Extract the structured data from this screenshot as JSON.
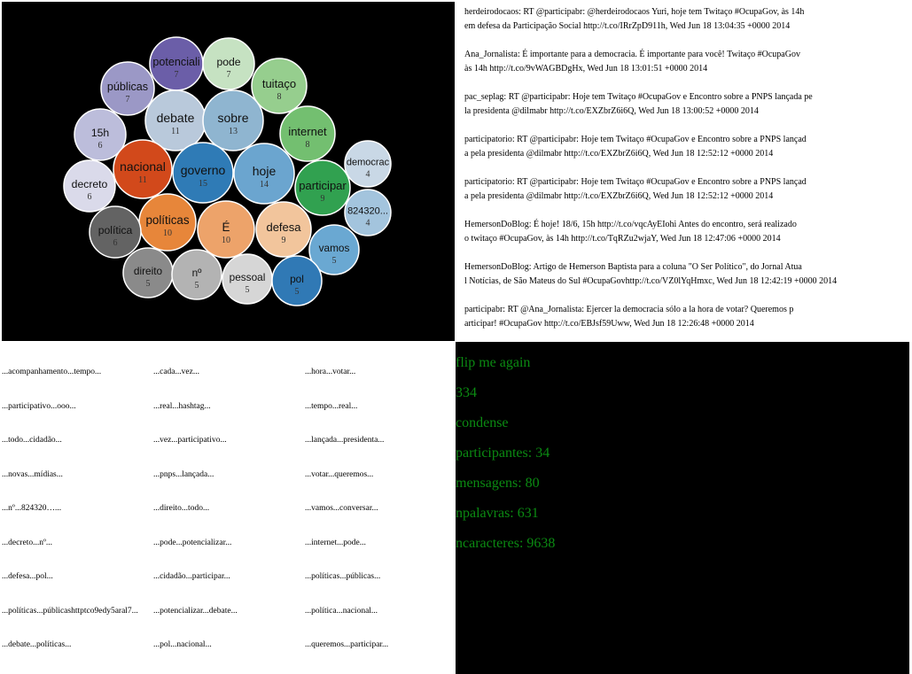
{
  "bubbles": [
    {
      "word": "potenciali",
      "count": "7",
      "color": "#6b5ea8"
    },
    {
      "word": "pode",
      "count": "7",
      "color": "#c6e2c2"
    },
    {
      "word": "públicas",
      "count": "7",
      "color": "#9b98c6"
    },
    {
      "word": "tuitaço",
      "count": "8",
      "color": "#96ce8e"
    },
    {
      "word": "debate",
      "count": "11",
      "color": "#b9c9db"
    },
    {
      "word": "sobre",
      "count": "13",
      "color": "#8fb5d0"
    },
    {
      "word": "15h",
      "count": "6",
      "color": "#bcbddb"
    },
    {
      "word": "internet",
      "count": "8",
      "color": "#73bf70"
    },
    {
      "word": "nacional",
      "count": "11",
      "color": "#d2491b"
    },
    {
      "word": "governo",
      "count": "15",
      "color": "#2f7bb6"
    },
    {
      "word": "hoje",
      "count": "14",
      "color": "#6ba5cf"
    },
    {
      "word": "democrac",
      "count": "4",
      "color": "#c9d8e6"
    },
    {
      "word": "decreto",
      "count": "6",
      "color": "#dadaea"
    },
    {
      "word": "participar",
      "count": "9",
      "color": "#31a150"
    },
    {
      "word": "824320...",
      "count": "4",
      "color": "#a3c4dd"
    },
    {
      "word": "políticas",
      "count": "10",
      "color": "#e7863a"
    },
    {
      "word": "É",
      "count": "10",
      "color": "#eda36a"
    },
    {
      "word": "política",
      "count": "6",
      "color": "#636363"
    },
    {
      "word": "defesa",
      "count": "9",
      "color": "#f2c59c"
    },
    {
      "word": "vamos",
      "count": "5",
      "color": "#6aa8d2"
    },
    {
      "word": "direito",
      "count": "5",
      "color": "#8a8a8a"
    },
    {
      "word": "nº",
      "count": "5",
      "color": "#b3b3b3"
    },
    {
      "word": "pessoal",
      "count": "5",
      "color": "#d6d6d6"
    },
    {
      "word": "pol",
      "count": "5",
      "color": "#3079b5"
    }
  ],
  "tweets": [
    {
      "l1": "herdeirodocaos: RT @participabr: @herdeirodocaos Yuri, hoje tem Twitaço #OcupaGov, às 14h",
      "l2": "em defesa da Participação Social http://t.co/IRrZpD911h, Wed Jun 18 13:04:35 +0000 2014"
    },
    {
      "l1": "Ana_Jornalista: É importante para a democracia. É importante para você! Twitaço #OcupaGov",
      "l2": "às 14h http://t.co/9vWAGBDgHx, Wed Jun 18 13:01:51 +0000 2014"
    },
    {
      "l1": "pac_seplag: RT @participabr: Hoje tem Twitaço #OcupaGov e Encontro sobre a PNPS lançada pe",
      "l2": "la presidenta @dilmabr http://t.co/EXZbrZ6i6Q, Wed Jun 18 13:00:52 +0000 2014"
    },
    {
      "l1": "participatorio: RT @participabr: Hoje tem Twitaço #OcupaGov e Encontro sobre a PNPS lançad",
      "l2": "a pela presidenta @dilmabr http://t.co/EXZbrZ6i6Q, Wed Jun 18 12:52:12 +0000 2014"
    },
    {
      "l1": "participatorio: RT @participabr: Hoje tem Twitaço #OcupaGov e Encontro sobre a PNPS lançad",
      "l2": "a pela presidenta @dilmabr http://t.co/EXZbrZ6i6Q, Wed Jun 18 12:52:12 +0000 2014"
    },
    {
      "l1": "HemersonDoBlog: É hoje! 18/6, 15h http://t.co/vqcAyEIohi Antes do encontro, será realizado",
      "l2": "o twitaço #OcupaGov, às 14h http://t.co/TqRZu2wjaY, Wed Jun 18 12:47:06 +0000 2014"
    },
    {
      "l1": "HemersonDoBlog: Artigo de Hemerson Baptista para a coluna \"O Ser Político\", do Jornal Atua",
      "l2": "l Notícias, de São Mateus do Sul #OcupaGovhttp://t.co/VZ0lYqHmxc, Wed Jun 18 12:42:19 +0000 2014"
    },
    {
      "l1": "participabr: RT @Ana_Jornalista: Ejercer la democracia sólo a la hora de votar? Queremos p",
      "l2": "articipar! #OcupaGov http://t.co/EBJsf59Uww, Wed Jun 18 12:26:48 +0000 2014"
    }
  ],
  "word_pairs": {
    "col1": [
      "...acompanhamento...tempo...",
      "...participativo...ooo...",
      "...todo...cidadão...",
      "...novas...mídias...",
      "...nº...824320…...",
      "...decreto...nº...",
      "...defesa...pol...",
      "...políticas...públicashttptco9edy5aral7...",
      "...debate...políticas..."
    ],
    "col2": [
      "...cada...vez...",
      "...real...hashtag...",
      "...vez...participativo...",
      "...pnps...lançada...",
      "...direito...todo...",
      "...pode...potencializar...",
      "...cidadão...participar...",
      "...potencializar...debate...",
      "...pol...nacional..."
    ],
    "col3": [
      "...hora...votar...",
      "...tempo...real...",
      "...lançada...presidenta...",
      "...votar...queremos...",
      "...vamos...conversar...",
      "...internet...pode...",
      "...políticas...públicas...",
      "...política...nacional...",
      "...queremos...participar..."
    ]
  },
  "controls": {
    "flip": "flip me again",
    "number": "334",
    "condense": "condense",
    "participantes": "participantes: 34",
    "mensagens": "mensagens: 80",
    "npalavras": "npalavras: 631",
    "ncaracteres": "ncaracteres: 9638"
  }
}
